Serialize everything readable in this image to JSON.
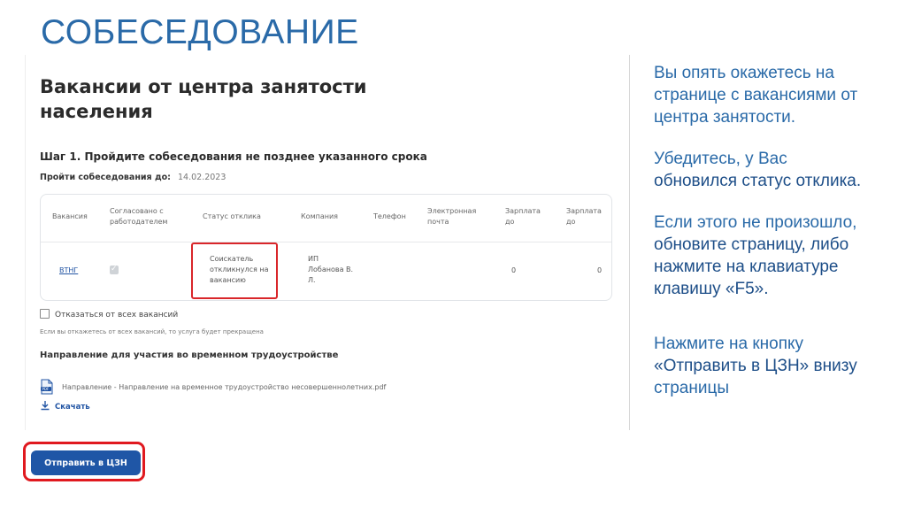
{
  "slide": {
    "title": "СОБЕСЕДОВАНИЕ"
  },
  "screen": {
    "page_heading": "Вакансии от центра занятости населения",
    "step_title": "Шаг 1. Пройдите собеседования не позднее указанного срока",
    "deadline_label": "Пройти собеседования до:",
    "deadline_value": "14.02.2023",
    "table": {
      "headers": [
        "Вакансия",
        "Согласовано с работодателем",
        "Статус отклика",
        "Компания",
        "Телефон",
        "Электронная почта",
        "Зарплата до",
        "Зарплата до"
      ],
      "row": {
        "vacancy": "ВТНГ",
        "agreed_checked": true,
        "status": "Соискатель откликнулся на вакансию",
        "company": "ИП Лобанова В. Л.",
        "phone": "",
        "email": "",
        "salary_to_1": "0",
        "salary_to_2": "0"
      }
    },
    "refuse_label": "Отказаться от всех вакансий",
    "refuse_note": "Если вы откажетесь от всех вакансий, то услуга будет прекращена",
    "direction_title": "Направление для участия во временном трудоустройстве",
    "file_name": "Направление - Направление на временное трудоустройство несовершеннолетних.pdf",
    "download_label": "Скачать",
    "submit_label": "Отправить в ЦЗН"
  },
  "instructions": {
    "p1": "Вы опять окажетесь на странице с вакансиями от центра занятости.",
    "p2a": "Убедитесь, у Вас",
    "p2b": "обновился статус отклика.",
    "p3a": "Если этого не произошло,",
    "p3b": "обновите страницу, либо нажмите на клавиатуре клавишу «F5».",
    "p4a": "Нажмите на кнопку",
    "p4b": "«Отправить в ЦЗН» внизу",
    "p4c": "страницы"
  },
  "colors": {
    "title_blue": "#2a6aa8",
    "highlight_red": "#d9262a",
    "button_blue": "#1f56a6"
  },
  "icons": [
    "pdf-file-icon",
    "download-icon",
    "checkbox-icon"
  ]
}
